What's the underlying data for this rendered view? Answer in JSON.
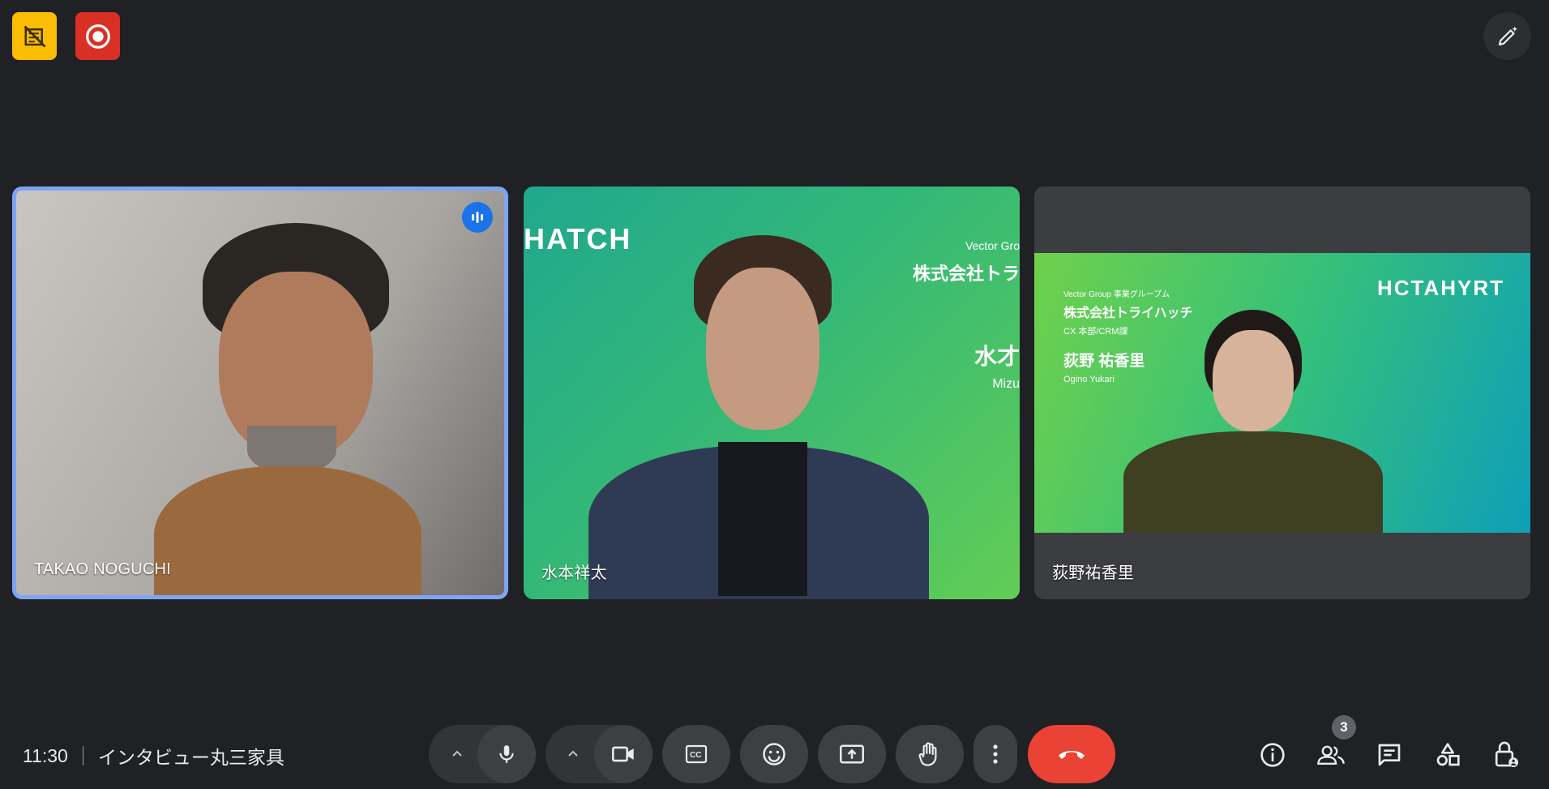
{
  "colors": {
    "background": "#202124",
    "control_bg": "#3c4043",
    "end_call": "#ea4335",
    "active_speaker_border": "#7ea4f3",
    "badge_yellow": "#fbbc04",
    "badge_red": "#d93025"
  },
  "top_left": {
    "badge1_icon": "no-video-recording-icon",
    "badge2_icon": "recording-icon"
  },
  "top_right": {
    "icon": "pen-sparkle-icon"
  },
  "participants": [
    {
      "name": "TAKAO NOGUCHI",
      "speaking": true
    },
    {
      "name": "水本祥太",
      "background_text": {
        "logo": "HATCH",
        "line1": "Vector Gro",
        "line2": "株式会社トラ",
        "line3": "水才",
        "line4": "Mizu"
      }
    },
    {
      "name": "荻野祐香里",
      "background_text": {
        "logo": "HCTAHYRT",
        "line1": "Vector Group 事業グループム",
        "line2": "株式会社トライハッチ",
        "line3": "CX 本部/CRM課",
        "line4": "荻野 祐香里",
        "line5": "Ogino Yukari"
      }
    }
  ],
  "meeting": {
    "time": "11:30",
    "title": "インタビュー丸三家具"
  },
  "controls": {
    "mic_icon": "mic-icon",
    "camera_icon": "camera-icon",
    "captions_icon": "closed-captions-icon",
    "emoji_icon": "emoji-icon",
    "present_icon": "present-screen-icon",
    "hand_icon": "raise-hand-icon",
    "more_icon": "more-vert-icon",
    "end_icon": "end-call-icon"
  },
  "right_controls": {
    "info_icon": "info-icon",
    "people_icon": "people-icon",
    "people_count": "3",
    "chat_icon": "chat-icon",
    "activities_icon": "activities-icon",
    "host_icon": "host-controls-icon"
  }
}
